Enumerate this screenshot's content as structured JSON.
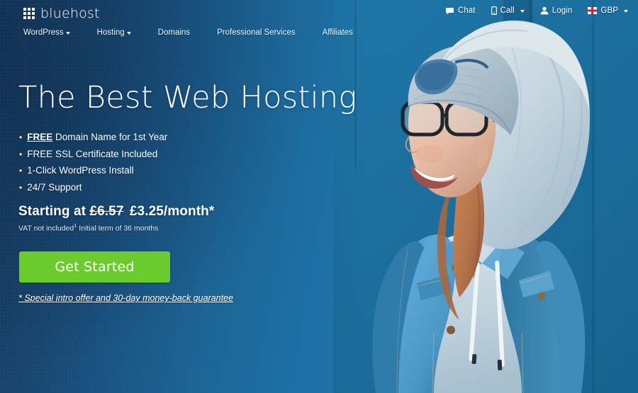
{
  "brand": {
    "logo_text": "bluehost",
    "logo_icon": "grid-squares-icon",
    "accent_green": "#6bcb2c",
    "background_dark_blue": "#173a5f",
    "background_light_blue": "#1e73a8"
  },
  "utility_nav": {
    "items": [
      {
        "label": "Chat",
        "icon": "chat-bubble-icon",
        "caret": false
      },
      {
        "label": "Call",
        "icon": "phone-icon",
        "caret": true
      },
      {
        "label": "Login",
        "icon": "user-icon",
        "caret": false
      },
      {
        "label": "GBP",
        "icon": "uk-flag-icon",
        "caret": true
      }
    ]
  },
  "main_nav": {
    "items": [
      {
        "label": "WordPress",
        "caret": true
      },
      {
        "label": "Hosting",
        "caret": true
      },
      {
        "label": "Domains",
        "caret": false
      },
      {
        "label": "Professional Services",
        "caret": false
      },
      {
        "label": "Affiliates",
        "caret": false
      }
    ]
  },
  "hero": {
    "headline": "The Best Web Hosting",
    "bullets": [
      {
        "strong": "FREE",
        "rest": " Domain Name for 1st Year"
      },
      {
        "strong": "",
        "rest": "FREE SSL Certificate Included"
      },
      {
        "strong": "",
        "rest": "1-Click WordPress Install"
      },
      {
        "strong": "",
        "rest": "24/7 Support"
      }
    ],
    "price_prefix": "Starting at",
    "price_old": "£6.57",
    "price_new": "£3.25/month*",
    "price_note_pre": "VAT not included",
    "price_note_sup": "1",
    "price_note_post": " Initial term of 36 months",
    "cta_label": "Get Started",
    "guarantee_label": "* Special intro offer and 30-day money-back guarantee"
  },
  "photo": {
    "alt": "Smiling young woman wearing glasses, grey hooded sweatshirt with hood up under a knit beanie, and a denim jacket, standing in front of a blue wall"
  }
}
